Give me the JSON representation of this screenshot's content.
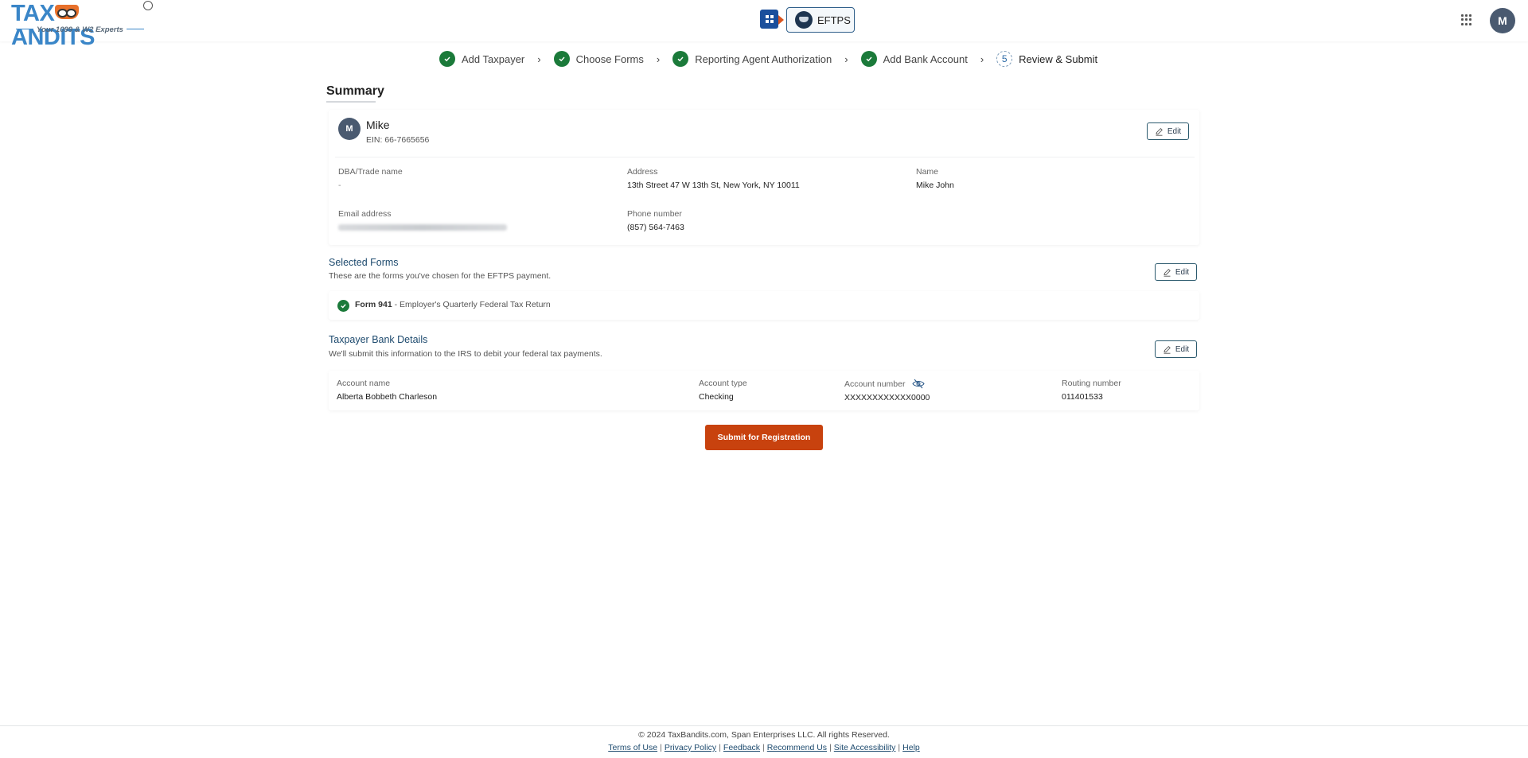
{
  "header": {
    "logo_text_left": "TAX",
    "logo_text_right": "ANDITS",
    "logo_tagline": "Your 1099 & W2 Experts",
    "logo_tm": "TM",
    "app_switch_icon": "app-switch-icon",
    "product_label": "EFTPS",
    "apps_icon": "grid-icon",
    "user_initial": "M"
  },
  "stepper": {
    "steps": [
      {
        "label": "Add Taxpayer",
        "status": "complete"
      },
      {
        "label": "Choose Forms",
        "status": "complete"
      },
      {
        "label": "Reporting Agent Authorization",
        "status": "complete"
      },
      {
        "label": "Add Bank Account",
        "status": "complete"
      },
      {
        "label": "Review & Submit",
        "status": "current",
        "number": "5"
      }
    ]
  },
  "summary": {
    "title": "Summary",
    "taxpayer": {
      "initial": "M",
      "name": "Mike",
      "ein": "EIN: 66-7665656",
      "edit_label": "Edit",
      "fields": {
        "dba_label": "DBA/Trade name",
        "dba_value": "-",
        "address_label": "Address",
        "address_value": "13th Street 47 W 13th St, New York, NY 10011",
        "name_label": "Name",
        "name_value": "Mike John",
        "email_label": "Email address",
        "email_value": "(blurred)",
        "phone_label": "Phone number",
        "phone_value": "(857) 564-7463"
      }
    },
    "selected_forms": {
      "title": "Selected Forms",
      "subtitle": "These are the forms you've chosen for the EFTPS payment.",
      "edit_label": "Edit",
      "items": [
        {
          "code": "Form 941",
          "separator": " - ",
          "description": "Employer's Quarterly Federal Tax Return"
        }
      ]
    },
    "bank_details": {
      "title": "Taxpayer Bank Details",
      "subtitle": "We'll submit this information to the IRS to debit your federal tax payments.",
      "edit_label": "Edit",
      "account_name_label": "Account name",
      "account_name_value": "Alberta Bobbeth Charleson",
      "account_type_label": "Account type",
      "account_type_value": "Checking",
      "account_number_label": "Account number",
      "account_number_value": "XXXXXXXXXXXX0000",
      "account_number_toggle_icon": "eye-slash-icon",
      "routing_number_label": "Routing number",
      "routing_number_value": "011401533"
    },
    "submit_label": "Submit for Registration"
  },
  "footer": {
    "copyright": "© 2024 TaxBandits.com, Span Enterprises LLC. All rights Reserved.",
    "links": [
      "Terms of Use",
      "Privacy Policy",
      "Feedback",
      "Recommend Us",
      "Site Accessibility",
      "Help"
    ]
  },
  "colors": {
    "brand_blue": "#3a86c8",
    "step_complete": "#1b7a3a",
    "section_title": "#1d4a6e",
    "submit_button": "#c8420e",
    "avatar": "#4a5a70"
  }
}
